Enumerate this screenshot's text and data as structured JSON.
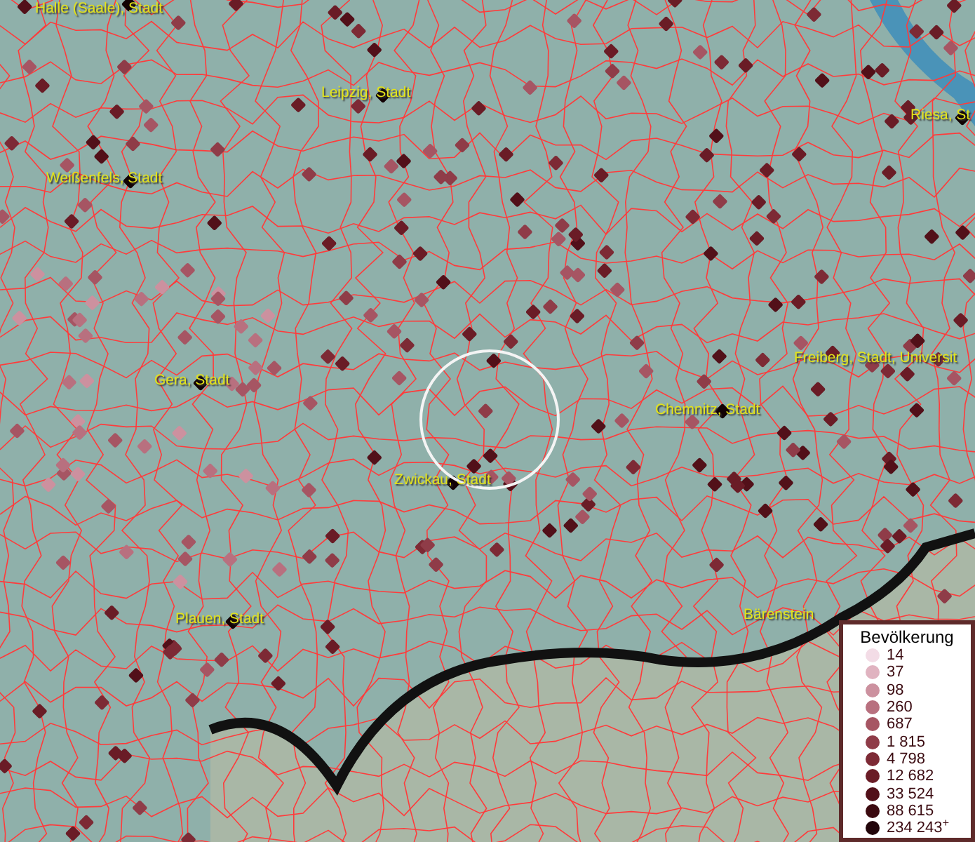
{
  "map_labels": [
    "Halle (Saale), Stadt",
    "Leipzig, Stadt",
    "Riesa, St",
    "Weißenfels, Stadt",
    "Freiberg, Stadt, Universit",
    "Gera, Stadt",
    "Chemnitz, Stadt",
    "Zwickau, Stadt",
    "Plauen, Stadt",
    "Bärenstein"
  ],
  "legend": {
    "title": "Bevölkerung",
    "items": [
      {
        "label": "14",
        "color": "#f3dce6"
      },
      {
        "label": "37",
        "color": "#e0b3c0"
      },
      {
        "label": "98",
        "color": "#cc919f"
      },
      {
        "label": "260",
        "color": "#b8707f"
      },
      {
        "label": "687",
        "color": "#a65563"
      },
      {
        "label": "1 815",
        "color": "#8f3c48"
      },
      {
        "label": "4 798",
        "color": "#7d2a35"
      },
      {
        "label": "12 682",
        "color": "#6a1c26"
      },
      {
        "label": "33 524",
        "color": "#521019"
      },
      {
        "label": "88 615",
        "color": "#3c0a10"
      },
      {
        "label": "234 243$^{+}$",
        "color": "#22050a"
      }
    ]
  }
}
